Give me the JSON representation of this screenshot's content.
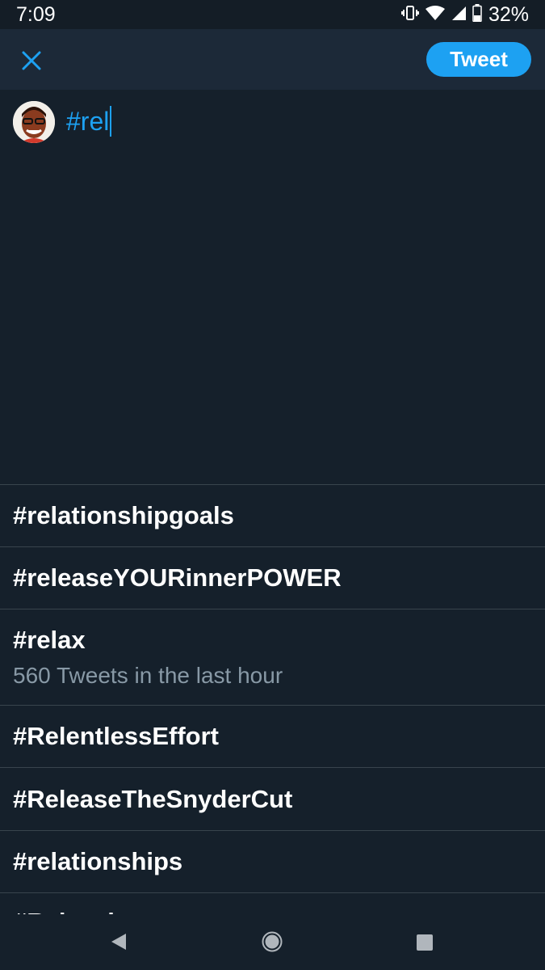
{
  "status_bar": {
    "time": "7:09",
    "battery": "32%",
    "icons": [
      "vibrate-icon",
      "wifi-icon",
      "signal-icon",
      "battery-icon"
    ]
  },
  "header": {
    "close_icon": "close-icon",
    "tweet_label": "Tweet",
    "accent_color": "#1da1f2"
  },
  "compose": {
    "text": "#rel"
  },
  "suggestions": [
    {
      "tag": "#relationshipgoals",
      "sub": ""
    },
    {
      "tag": "#releaseYOURinnerPOWER",
      "sub": ""
    },
    {
      "tag": "#relax",
      "sub": "560 Tweets in the last hour"
    },
    {
      "tag": "#RelentlessEffort",
      "sub": ""
    },
    {
      "tag": "#ReleaseTheSnyderCut",
      "sub": ""
    },
    {
      "tag": "#relationships",
      "sub": ""
    },
    {
      "tag": "#Relevel",
      "sub": ""
    }
  ],
  "nav": {
    "back_icon": "back-icon",
    "home_icon": "home-icon",
    "recents_icon": "recents-icon"
  }
}
